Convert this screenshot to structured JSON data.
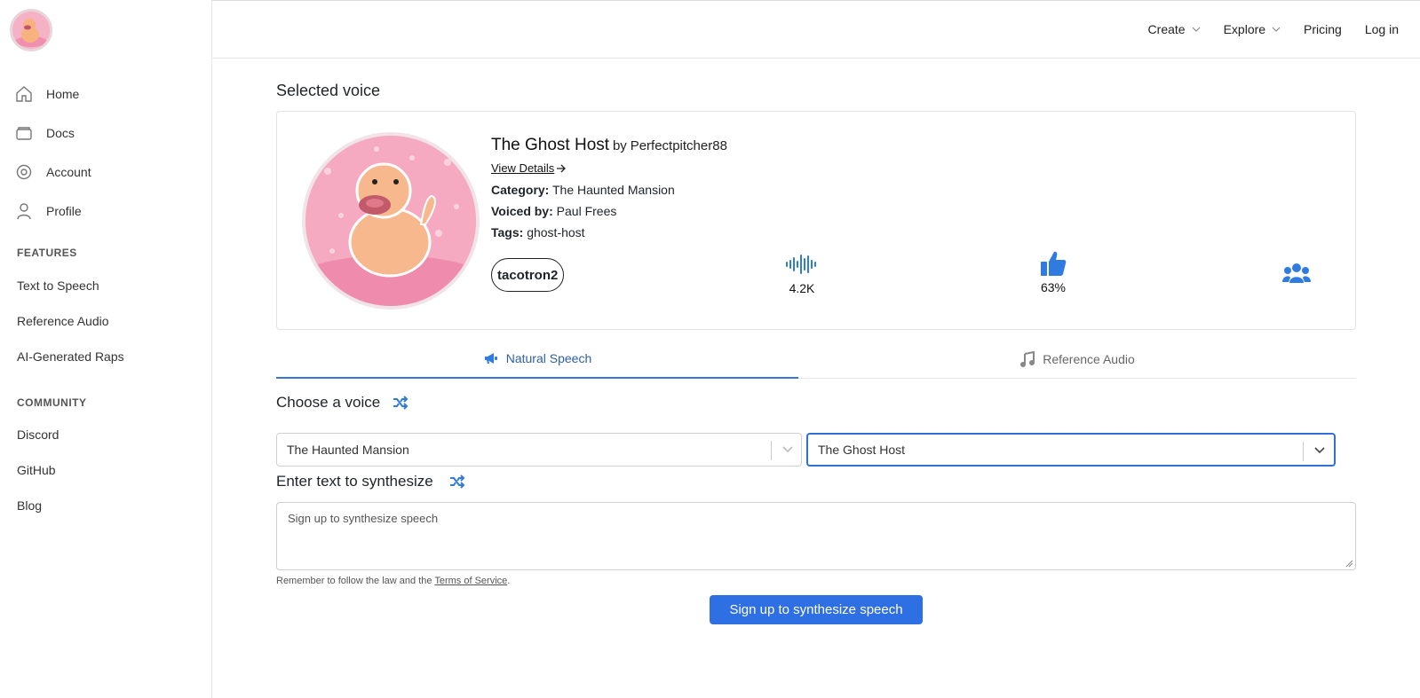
{
  "sidebar": {
    "logo_alt": "duck avatar",
    "main_items": [
      {
        "label": "Home",
        "icon": "home-icon"
      },
      {
        "label": "Docs",
        "icon": "docs-icon"
      },
      {
        "label": "Account",
        "icon": "gear-icon"
      },
      {
        "label": "Profile",
        "icon": "user-icon"
      }
    ],
    "features_label": "FEATURES",
    "features": [
      "Text to Speech",
      "Reference Audio",
      "AI-Generated Raps"
    ],
    "community_label": "COMMUNITY",
    "community": [
      "Discord",
      "GitHub",
      "Blog"
    ]
  },
  "topnav": {
    "create": "Create",
    "explore": "Explore",
    "pricing": "Pricing",
    "login": "Log in"
  },
  "selected": {
    "heading": "Selected voice",
    "name": "The Ghost Host",
    "by_prefix": "by",
    "author": "Perfectpitcher88",
    "view_details": "View Details",
    "category_label": "Category:",
    "category": "The Haunted Mansion",
    "voiced_label": "Voiced by:",
    "voiced_by": "Paul Frees",
    "tags_label": "Tags:",
    "tags": "ghost-host",
    "model": "tacotron2",
    "uses": "4.2K",
    "likes": "63%"
  },
  "tabs": {
    "natural": "Natural Speech",
    "reference": "Reference Audio"
  },
  "form": {
    "choose_label": "Choose a voice",
    "category_value": "The Haunted Mansion",
    "voice_value": "The Ghost Host",
    "text_label": "Enter text to synthesize",
    "text_placeholder": "Sign up to synthesize speech",
    "note_prefix": "Remember to follow the law and the",
    "note_link": "Terms of Service",
    "note_suffix": ".",
    "submit": "Sign up to synthesize speech"
  },
  "colors": {
    "accent": "#2f6fe4",
    "tab_active": "#3477d9",
    "icon_blue": "#2f7be0"
  }
}
